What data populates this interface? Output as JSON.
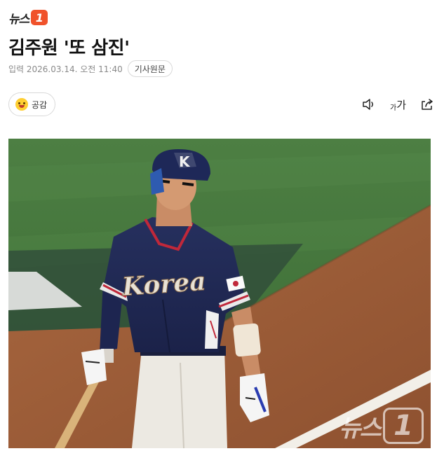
{
  "brand": {
    "name": "뉴스",
    "badge": "1",
    "accent": "#f0522b"
  },
  "article": {
    "title": "김주원 '또 삼진'",
    "date": "입력 2026.03.14. 오전 11:40",
    "source_button": "기사원문"
  },
  "reaction": {
    "emoji": "grinning-face-icon",
    "label": "공감"
  },
  "tools": {
    "speaker_icon": "speaker-icon",
    "font_size_small": "가",
    "font_size_large": "가",
    "share_icon": "share-icon"
  },
  "photo": {
    "watermark_text": "뉴스",
    "watermark_badge": "1",
    "jersey_text": "Korea",
    "cap_letter": "K"
  }
}
